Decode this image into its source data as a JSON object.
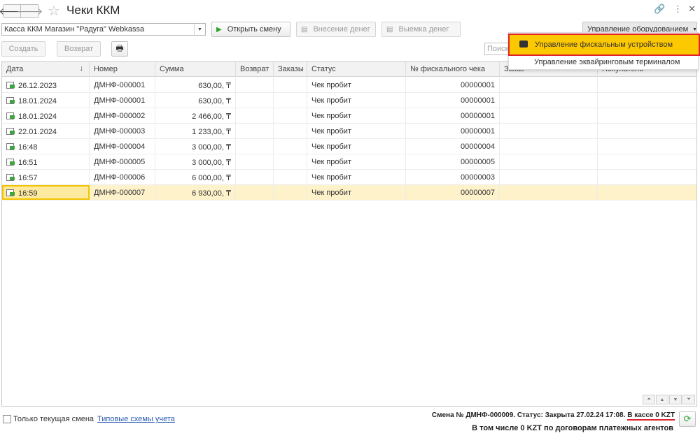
{
  "window": {
    "title": "Чеки ККМ",
    "icons": {
      "back": "arrow-left-icon",
      "forward": "arrow-right-icon",
      "favorite": "star-icon",
      "link": "link-icon",
      "more": "more-vert-icon",
      "close": "close-icon"
    }
  },
  "toolbar": {
    "kassa_value": "Касса ККМ Магазин \"Радуга\" Webkassa",
    "open_shift": "Открыть смену",
    "deposit": "Внесение денег",
    "withdraw": "Выемка денег",
    "equipment": "Управление оборудованием",
    "create": "Создать",
    "return": "Возврат",
    "search_placeholder": "Поиск"
  },
  "dropdown": {
    "items": [
      {
        "label": "Управление фискальным устройством"
      },
      {
        "label": "Управление эквайринговым терминалом"
      }
    ]
  },
  "table": {
    "columns": [
      "Дата",
      "Номер",
      "Сумма",
      "Возврат",
      "Заказы",
      "Статус",
      "№ фискального чека",
      "Заказ",
      "Покупатель"
    ],
    "sort_indicator": "↓",
    "rows": [
      {
        "date": "26.12.2023",
        "number": "ДМНФ-000001",
        "sum": "630,00, ₸",
        "status": "Чек пробит",
        "fiscal": "00000001"
      },
      {
        "date": "18.01.2024",
        "number": "ДМНФ-000001",
        "sum": "630,00, ₸",
        "status": "Чек пробит",
        "fiscal": "00000001"
      },
      {
        "date": "18.01.2024",
        "number": "ДМНФ-000002",
        "sum": "2 466,00, ₸",
        "status": "Чек пробит",
        "fiscal": "00000001"
      },
      {
        "date": "22.01.2024",
        "number": "ДМНФ-000003",
        "sum": "1 233,00, ₸",
        "status": "Чек пробит",
        "fiscal": "00000001"
      },
      {
        "date": "16:48",
        "number": "ДМНФ-000004",
        "sum": "3 000,00, ₸",
        "status": "Чек пробит",
        "fiscal": "00000004"
      },
      {
        "date": "16:51",
        "number": "ДМНФ-000005",
        "sum": "3 000,00, ₸",
        "status": "Чек пробит",
        "fiscal": "00000005"
      },
      {
        "date": "16:57",
        "number": "ДМНФ-000006",
        "sum": "6 000,00, ₸",
        "status": "Чек пробит",
        "fiscal": "00000003"
      },
      {
        "date": "16:59",
        "number": "ДМНФ-000007",
        "sum": "6 930,00, ₸",
        "status": "Чек пробит",
        "fiscal": "00000007"
      }
    ]
  },
  "footer": {
    "only_current_shift": "Только текущая смена",
    "accounting_schemes": "Типовые схемы учета",
    "shift_status": "Смена № ДМНФ-000009. Статус: Закрыта 27.02.24 17:08.",
    "in_cash": "В кассе 0 KZT",
    "agents": "В том числе 0 KZT по договорам платежных агентов"
  },
  "colors": {
    "highlight": "#fcc800",
    "annotation_red": "#e0222a",
    "selected_row": "#fdf2c9",
    "link": "#2a5ab0"
  }
}
